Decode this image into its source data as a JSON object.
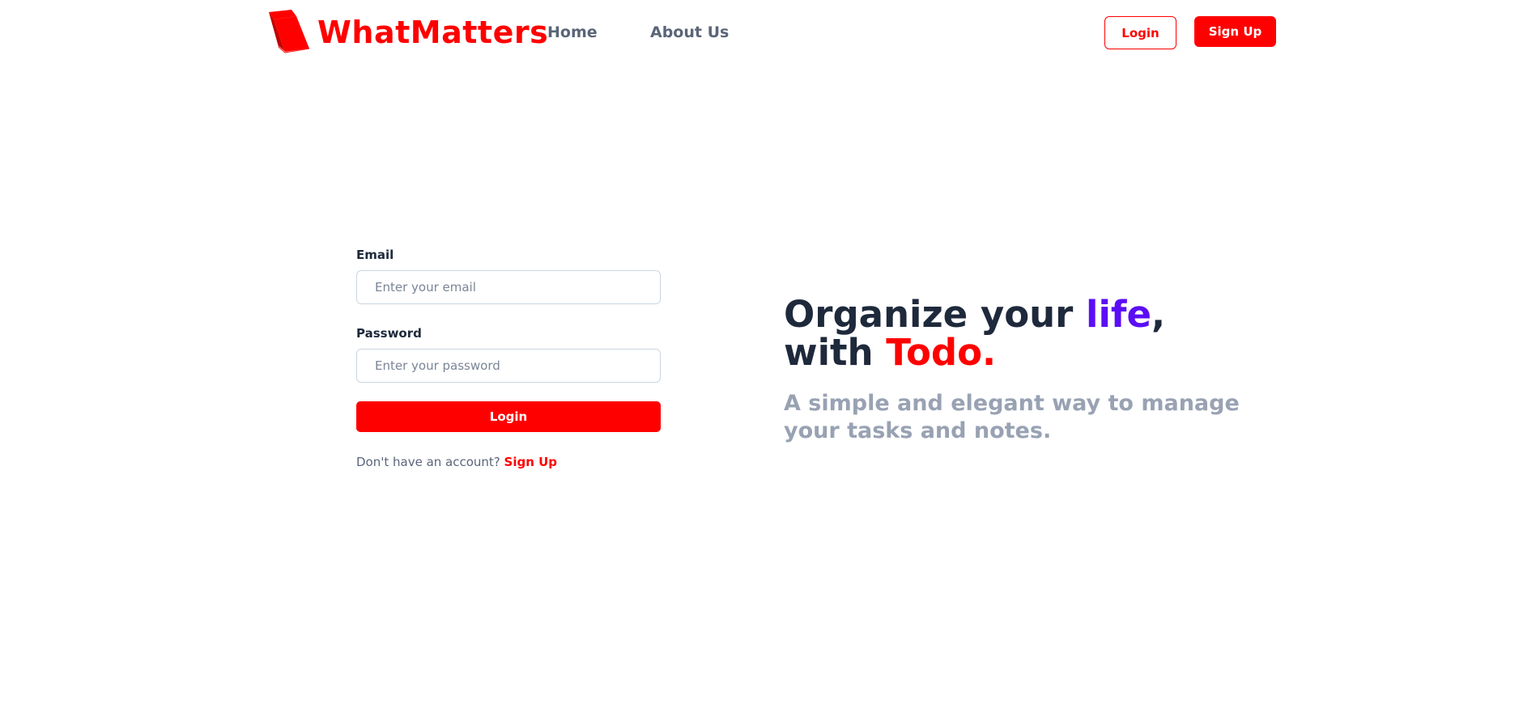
{
  "brand": {
    "name": "WhatMatters",
    "color": "#ff0000"
  },
  "nav": {
    "items": [
      {
        "label": "Home"
      },
      {
        "label": "About Us"
      }
    ],
    "login_label": "Login",
    "signup_label": "Sign Up"
  },
  "form": {
    "email_label": "Email",
    "email_placeholder": "Enter your email",
    "email_value": "",
    "password_label": "Password",
    "password_placeholder": "Enter your password",
    "password_value": "",
    "submit_label": "Login",
    "no_account_text": "Don't have an account? ",
    "signup_link": "Sign Up"
  },
  "hero": {
    "title_part1": "Organize your ",
    "title_highlight1": "life",
    "title_part2": ",",
    "title_line2_part1": "with ",
    "title_highlight2": "Todo.",
    "subtitle_line1": "A simple and elegant way to manage",
    "subtitle_line2": "your tasks and notes."
  },
  "colors": {
    "accent": "#ff0000",
    "highlight_purple": "#5b0ef5",
    "heading": "#1e293b",
    "muted": "#98a2b3"
  },
  "icons": {
    "logo": "book-icon"
  }
}
